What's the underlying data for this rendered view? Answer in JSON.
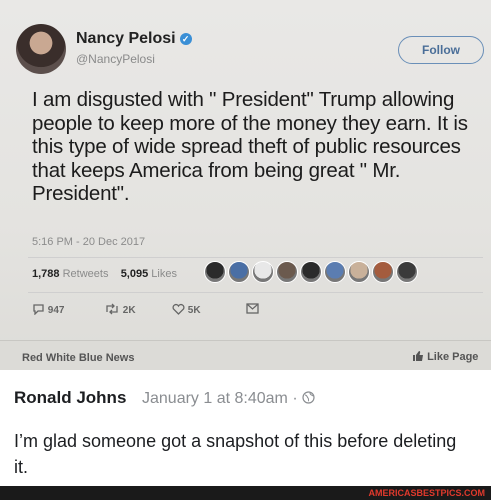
{
  "tweet_card": {
    "author_name": "Nancy Pelosi",
    "verified_glyph": "✓",
    "handle": "@NancyPelosi",
    "follow_label": "Follow",
    "text": "I am disgusted with \" President\" Trump allowing people to keep more of the money they earn.  It is this type of wide spread theft of public resources that keeps America from being great \" Mr. President\".",
    "timestamp": "5:16 PM - 20 Dec 2017",
    "retweets_count": "1,788",
    "retweets_label": "Retweets",
    "likes_count": "5,095",
    "likes_label": "Likes",
    "likers_colors": [
      "#2b2b2b",
      "#4a6fa5",
      "#e8e8e8",
      "#6b5a4e",
      "#2b2b2b",
      "#5b7db1",
      "#c9b19a",
      "#a45c3e",
      "#3b3b3b"
    ],
    "actions": [
      {
        "icon": "reply-icon",
        "count": "947"
      },
      {
        "icon": "retweet-icon",
        "count": "2K"
      },
      {
        "icon": "heart-icon",
        "count": "5K"
      },
      {
        "icon": "direct-message-icon",
        "count": ""
      }
    ]
  },
  "source_bar": {
    "page_name": "Red White Blue News",
    "like_page_label": "Like Page"
  },
  "comment": {
    "author": "Ronald Johns",
    "date": "January 1 at 8:40am ·",
    "globe_icon": "globe-icon",
    "text": "I’m glad someone got a snapshot of this before deleting it."
  },
  "footer": {
    "watermark": "AMERICASBESTPICS.COM"
  }
}
